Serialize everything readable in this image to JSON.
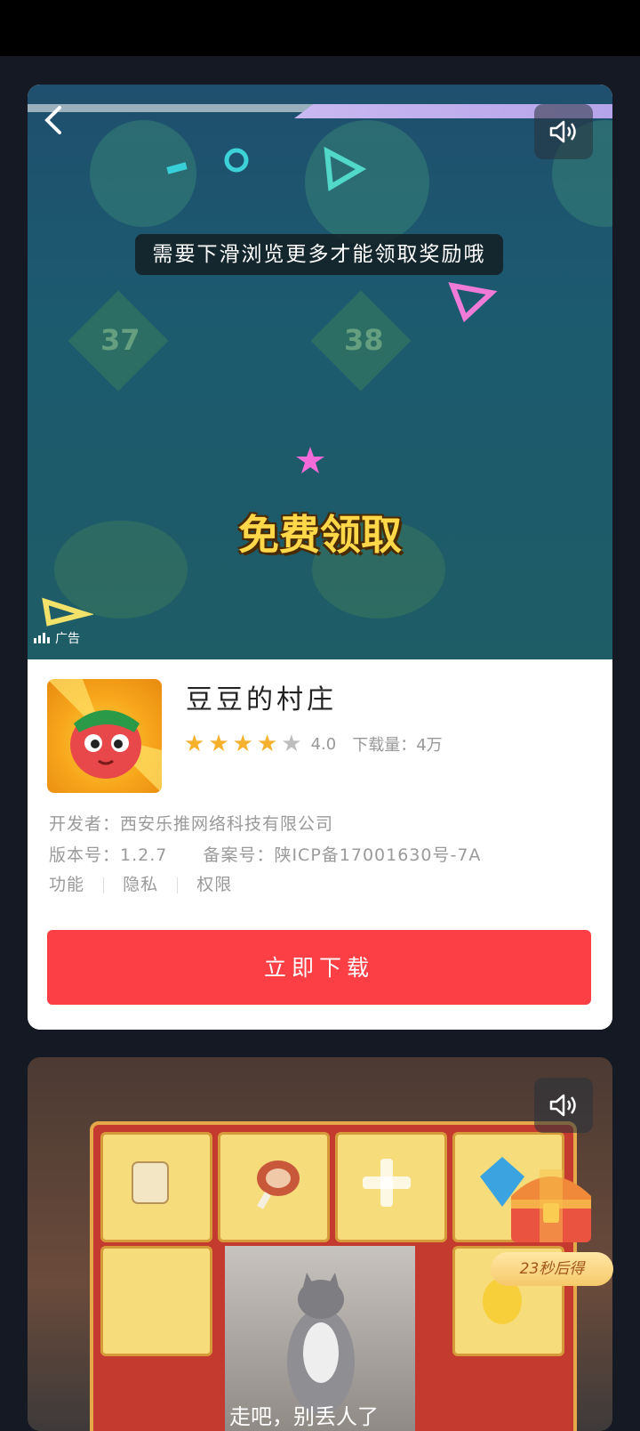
{
  "ad_card_1": {
    "hint_text": "需要下滑浏览更多才能领取奖励哦",
    "promo_text": "免费领取",
    "ad_label": "广告",
    "app": {
      "name": "豆豆的村庄",
      "rating": 4,
      "rating_text": "4.0",
      "downloads_text": "下载量：4万",
      "developer_text": "开发者：西安乐推网络科技有限公司",
      "version_text": "版本号：1.2.7",
      "record_text": "备案号：陕ICP备17001630号-7A",
      "links": [
        "功能",
        "隐私",
        "权限"
      ]
    },
    "download_button": "立即下载"
  },
  "ad_card_2": {
    "timer_text": "23秒后得",
    "caption": "走吧，别丢人了"
  },
  "colors": {
    "accent_red": "#fc3f44",
    "star_on": "#f6b12c",
    "star_off": "#bdbdbd"
  },
  "icons": [
    "back-arrow-icon",
    "speaker-icon",
    "star-icon",
    "treasure-chest-icon"
  ]
}
